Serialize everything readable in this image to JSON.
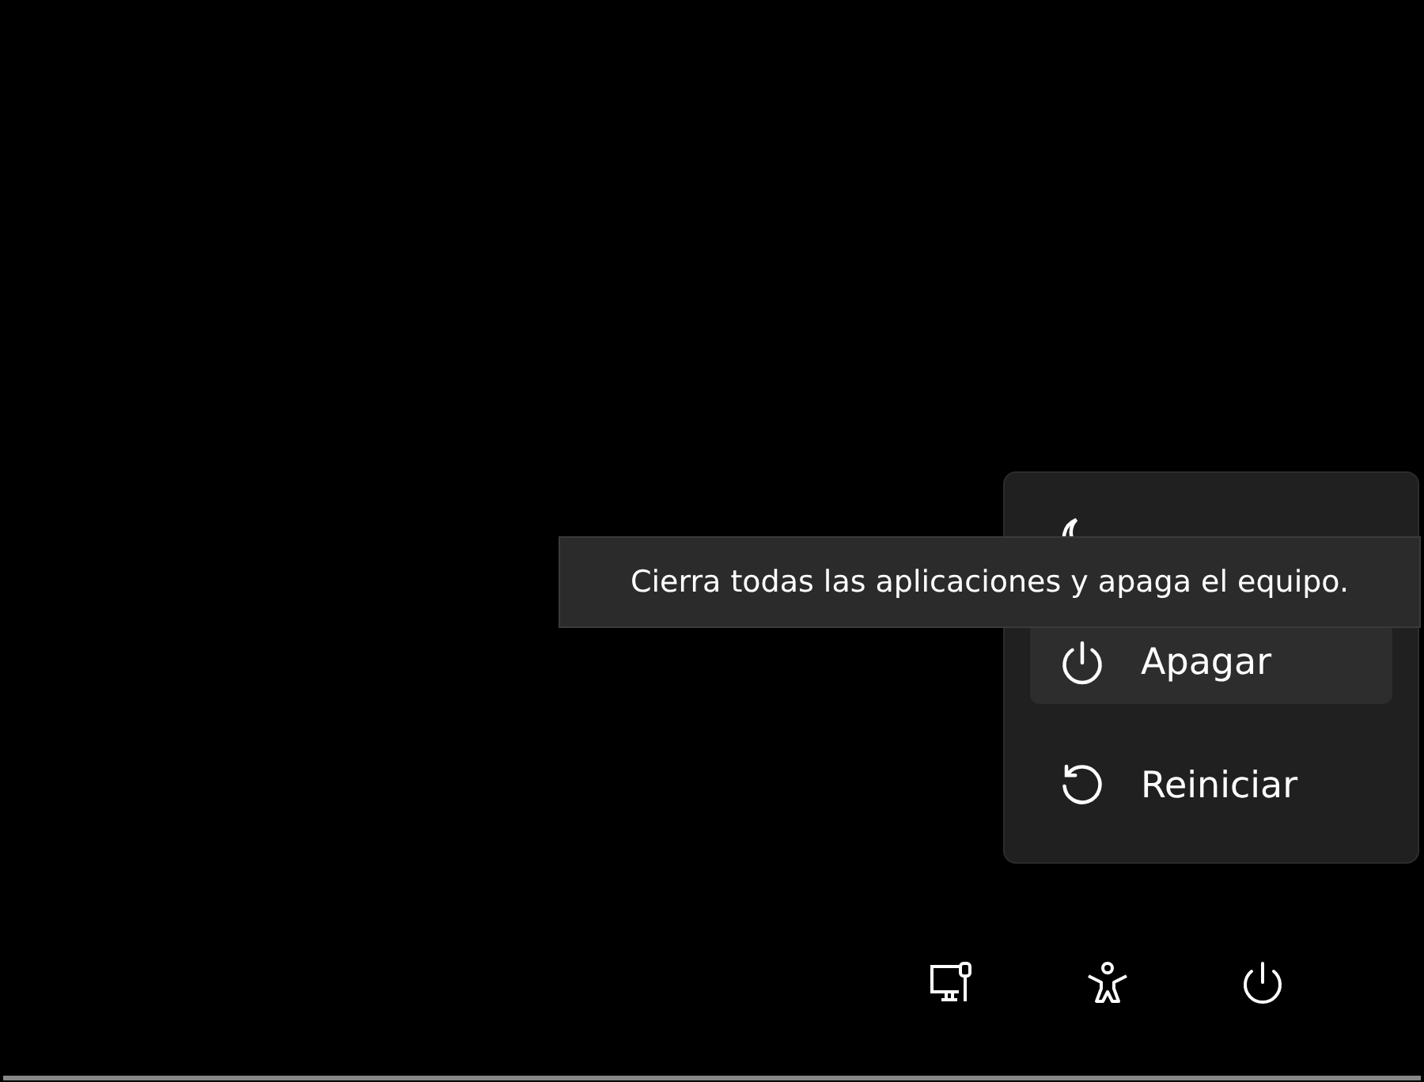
{
  "power_menu": {
    "items": [
      {
        "kind": "sleep",
        "selected": false
      },
      {
        "kind": "shutdown",
        "label": "Apagar",
        "selected": true
      },
      {
        "kind": "restart",
        "label": "Reiniciar",
        "selected": false
      }
    ]
  },
  "tooltip": {
    "text": "Cierra todas las aplicaciones y apaga el equipo."
  },
  "bottom_bar": [
    {
      "kind": "network"
    },
    {
      "kind": "accessibility"
    },
    {
      "kind": "power"
    }
  ]
}
